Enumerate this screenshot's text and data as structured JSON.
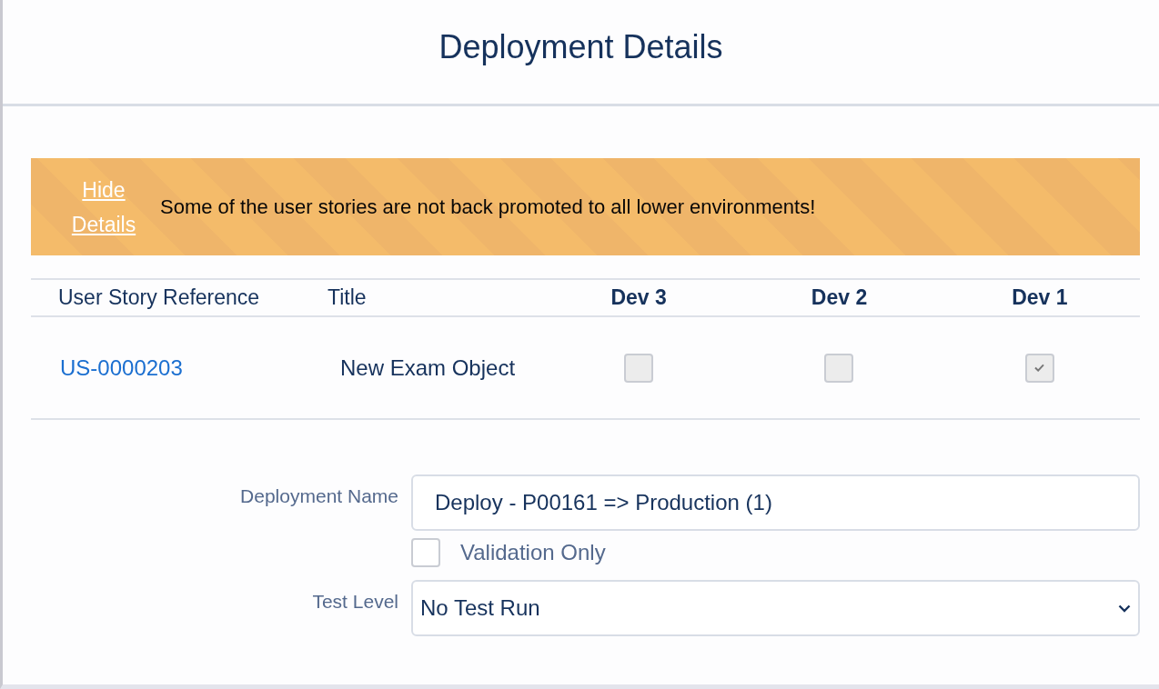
{
  "modal": {
    "title": "Deployment Details"
  },
  "banner": {
    "toggle_link": "Hide Details",
    "message": "Some of the user stories are not back promoted to all lower environments!"
  },
  "table": {
    "columns": [
      "User Story Reference",
      "Title",
      "Dev 3",
      "Dev 2",
      "Dev 1"
    ],
    "rows": [
      {
        "reference": "US-0000203",
        "title": "New Exam Object",
        "environments": [
          {
            "checked": false
          },
          {
            "checked": false
          },
          {
            "checked": true
          }
        ]
      }
    ]
  },
  "form": {
    "name_label": "Deployment Name",
    "name_value": "Deploy - P00161 => Production (1)",
    "validation": {
      "label": "Validation Only",
      "checked": false
    },
    "test_level_label": "Test Level",
    "test_level_value": "No Test Run"
  }
}
